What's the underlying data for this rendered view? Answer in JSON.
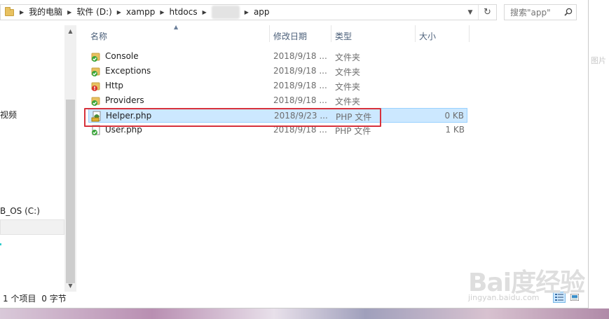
{
  "breadcrumb": {
    "items": [
      "我的电脑",
      "软件 (D:)",
      "xampp",
      "htdocs",
      "app"
    ]
  },
  "search": {
    "placeholder": "搜索\"app\""
  },
  "nav": {
    "visible_labels": [
      "视频",
      "B_OS (C:)"
    ]
  },
  "columns": {
    "name": "名称",
    "date": "修改日期",
    "type": "类型",
    "size": "大小"
  },
  "files": [
    {
      "name": "Console",
      "date": "2018/9/18 ...",
      "type": "文件夹",
      "size": "",
      "icon": "folder-check-icon"
    },
    {
      "name": "Exceptions",
      "date": "2018/9/18 ...",
      "type": "文件夹",
      "size": "",
      "icon": "folder-check-icon"
    },
    {
      "name": "Http",
      "date": "2018/9/18 ...",
      "type": "文件夹",
      "size": "",
      "icon": "folder-error-icon"
    },
    {
      "name": "Providers",
      "date": "2018/9/18 ...",
      "type": "文件夹",
      "size": "",
      "icon": "folder-check-icon"
    },
    {
      "name": "Helper.php",
      "date": "2018/9/23 ...",
      "type": "PHP 文件",
      "size": "0 KB",
      "icon": "php-file-warning-icon",
      "selected": true
    },
    {
      "name": "User.php",
      "date": "2018/9/18 ...",
      "type": "PHP 文件",
      "size": "1 KB",
      "icon": "php-file-check-icon"
    }
  ],
  "status": {
    "item_count": "1 个项目",
    "selected_size": "0 字节"
  },
  "right_edge_text": "图片",
  "watermark": {
    "brand": "Bai度经验",
    "url": "jingyan.baidu.com"
  },
  "colors": {
    "selection_bg": "#cce8ff",
    "selection_border": "#99d1ff",
    "highlight_box": "#d7323c",
    "header_text": "#4c607a"
  }
}
